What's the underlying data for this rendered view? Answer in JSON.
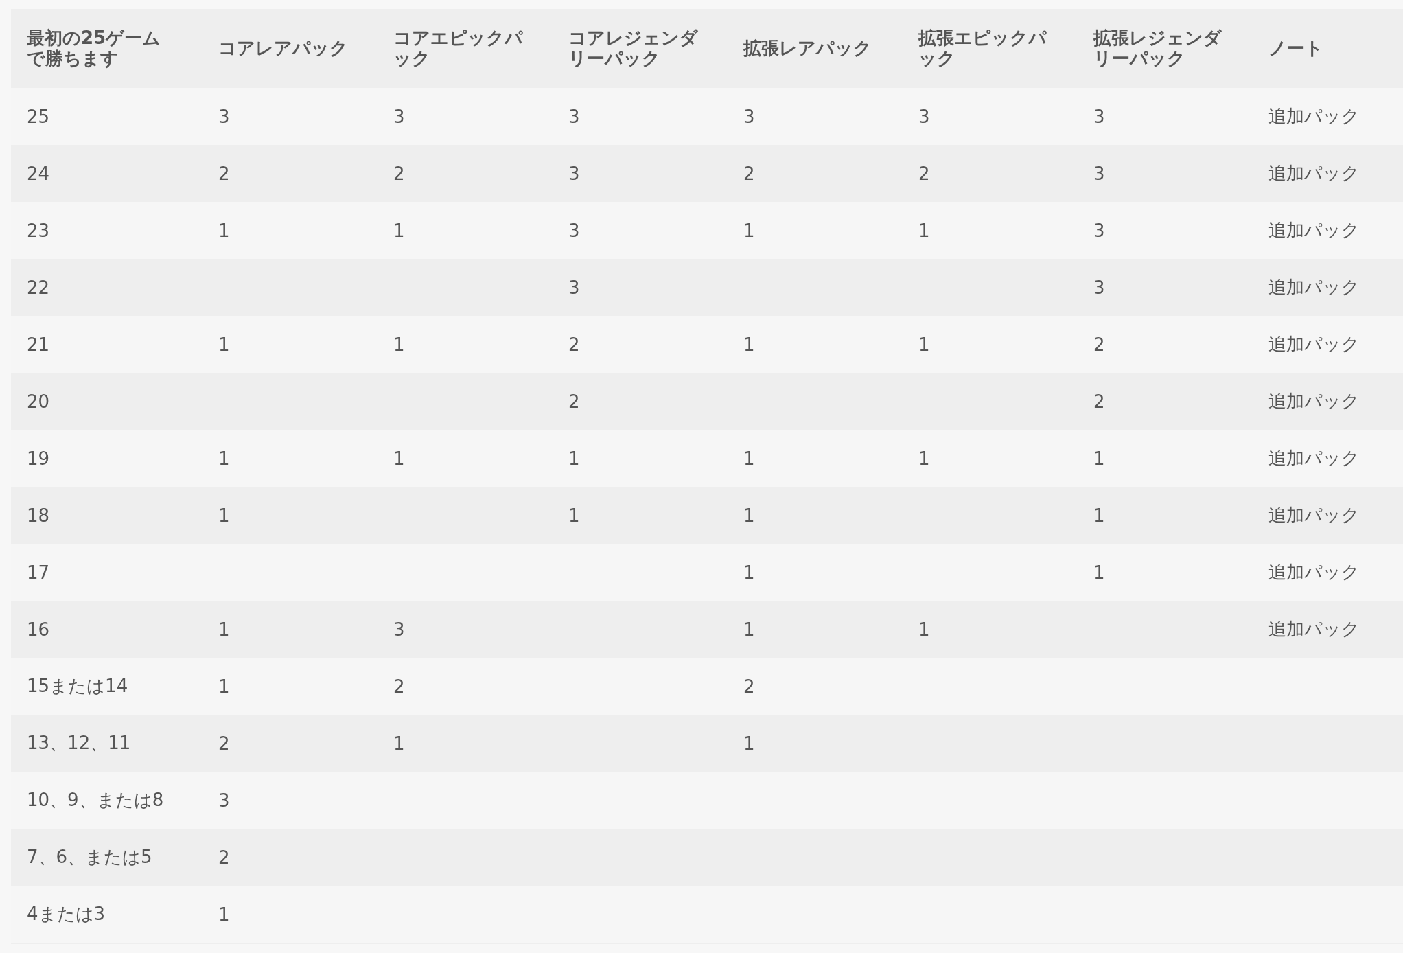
{
  "table": {
    "columns": [
      "最初の25ゲームで勝ちます",
      "コアレアパック",
      "コアエピックパック",
      "コアレジェンダリーパック",
      "拡張レアパック",
      "拡張エピックパック",
      "拡張レジェンダリーパック",
      "ノート"
    ],
    "rows": [
      {
        "cells": [
          "25",
          "3",
          "3",
          "3",
          "3",
          "3",
          "3",
          "追加パック"
        ]
      },
      {
        "cells": [
          "24",
          "2",
          "2",
          "3",
          "2",
          "2",
          "3",
          "追加パック"
        ]
      },
      {
        "cells": [
          "23",
          "1",
          "1",
          "3",
          "1",
          "1",
          "3",
          "追加パック"
        ]
      },
      {
        "cells": [
          "22",
          null,
          null,
          "3",
          null,
          null,
          "3",
          "追加パック"
        ]
      },
      {
        "cells": [
          "21",
          "1",
          "1",
          "2",
          "1",
          "1",
          "2",
          "追加パック"
        ]
      },
      {
        "cells": [
          "20",
          null,
          null,
          "2",
          null,
          null,
          "2",
          "追加パック"
        ]
      },
      {
        "cells": [
          "19",
          "1",
          "1",
          "1",
          "1",
          "1",
          "1",
          "追加パック"
        ]
      },
      {
        "cells": [
          "18",
          "1",
          null,
          "1",
          "1",
          null,
          "1",
          "追加パック"
        ]
      },
      {
        "cells": [
          "17",
          null,
          null,
          null,
          "1",
          null,
          "1",
          "追加パック"
        ]
      },
      {
        "cells": [
          "16",
          "1",
          "3",
          null,
          "1",
          "1",
          null,
          "追加パック"
        ]
      },
      {
        "cells": [
          "15または14",
          "1",
          "2",
          null,
          "2",
          null,
          null,
          null
        ]
      },
      {
        "cells": [
          "13、12、11",
          "2",
          "1",
          null,
          "1",
          null,
          null,
          null
        ]
      },
      {
        "cells": [
          "10、9、または8",
          "3",
          null,
          null,
          null,
          null,
          null,
          null
        ]
      },
      {
        "cells": [
          "7、6、または5",
          "2",
          null,
          null,
          null,
          null,
          null,
          null
        ]
      },
      {
        "cells": [
          "4または3",
          "1",
          null,
          null,
          null,
          null,
          null,
          null
        ]
      }
    ]
  }
}
